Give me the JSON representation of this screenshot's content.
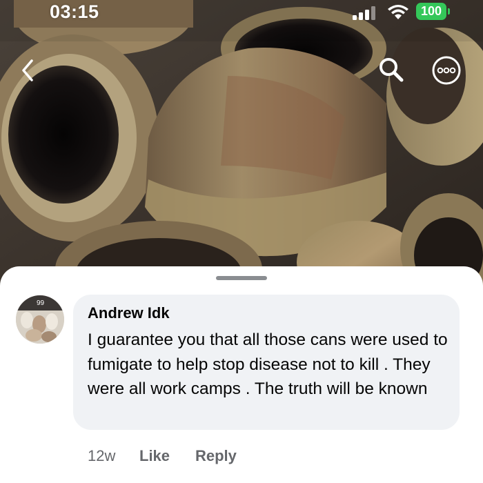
{
  "status_bar": {
    "time": "03:15",
    "battery": "100",
    "battery_color": "#34c759"
  },
  "nav": {
    "back_icon": "chevron-left-icon",
    "search_icon": "search-icon",
    "more_icon": "more-options-icon"
  },
  "comment": {
    "author": "Andrew Idk",
    "text": "I guarantee you that all those cans were used to fumigate to help stop disease not to kill . They were all work camps . The truth will be known",
    "age": "12w",
    "like_label": "Like",
    "reply_label": "Reply",
    "avatar_badge": "99"
  },
  "colors": {
    "bubble": "#f0f2f5",
    "meta_text": "#65676b",
    "grabber": "#8a8d91"
  }
}
